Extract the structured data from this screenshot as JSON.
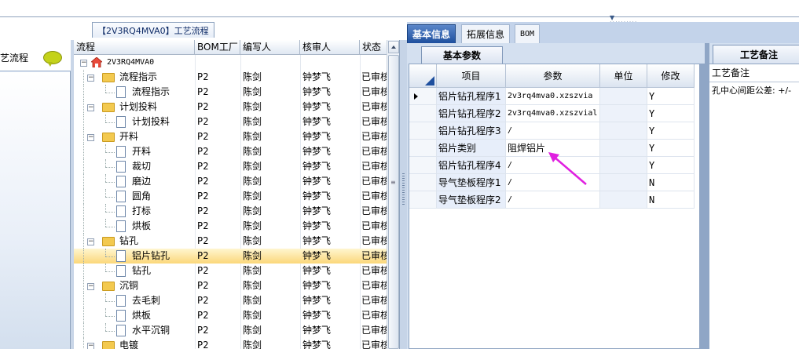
{
  "caption": "【2V3RQ4MVA0】工艺流程",
  "left_panel": {
    "label": "艺流程",
    "icon": "chat-bubble-icon"
  },
  "tree": {
    "columns": [
      "流程",
      "BOM工厂",
      "编写人",
      "核审人",
      "状态"
    ],
    "root": "2V3RQ4MVA0",
    "rows": [
      {
        "name": "流程指示",
        "type": "folder",
        "level": 1,
        "bom": "P2",
        "writer": "陈剑",
        "reviewer": "钟梦飞",
        "status": "已审核"
      },
      {
        "name": "流程指示",
        "type": "doc",
        "level": 2,
        "bom": "P2",
        "writer": "陈剑",
        "reviewer": "钟梦飞",
        "status": "已审核"
      },
      {
        "name": "计划投料",
        "type": "folder",
        "level": 1,
        "bom": "P2",
        "writer": "陈剑",
        "reviewer": "钟梦飞",
        "status": "已审核"
      },
      {
        "name": "计划投料",
        "type": "doc",
        "level": 2,
        "bom": "P2",
        "writer": "陈剑",
        "reviewer": "钟梦飞",
        "status": "已审核"
      },
      {
        "name": "开料",
        "type": "folder",
        "level": 1,
        "bom": "P2",
        "writer": "陈剑",
        "reviewer": "钟梦飞",
        "status": "已审核"
      },
      {
        "name": "开料",
        "type": "doc",
        "level": 2,
        "bom": "P2",
        "writer": "陈剑",
        "reviewer": "钟梦飞",
        "status": "已审核"
      },
      {
        "name": "裁切",
        "type": "doc",
        "level": 2,
        "bom": "P2",
        "writer": "陈剑",
        "reviewer": "钟梦飞",
        "status": "已审核"
      },
      {
        "name": "磨边",
        "type": "doc",
        "level": 2,
        "bom": "P2",
        "writer": "陈剑",
        "reviewer": "钟梦飞",
        "status": "已审核"
      },
      {
        "name": "圆角",
        "type": "doc",
        "level": 2,
        "bom": "P2",
        "writer": "陈剑",
        "reviewer": "钟梦飞",
        "status": "已审核"
      },
      {
        "name": "打标",
        "type": "doc",
        "level": 2,
        "bom": "P2",
        "writer": "陈剑",
        "reviewer": "钟梦飞",
        "status": "已审核"
      },
      {
        "name": "烘板",
        "type": "doc",
        "level": 2,
        "bom": "P2",
        "writer": "陈剑",
        "reviewer": "钟梦飞",
        "status": "已审核"
      },
      {
        "name": "钻孔",
        "type": "folder",
        "level": 1,
        "bom": "P2",
        "writer": "陈剑",
        "reviewer": "钟梦飞",
        "status": "已审核"
      },
      {
        "name": "铝片钻孔",
        "type": "doc",
        "level": 2,
        "bom": "P2",
        "writer": "陈剑",
        "reviewer": "钟梦飞",
        "status": "已审核",
        "selected": true
      },
      {
        "name": "钻孔",
        "type": "doc",
        "level": 2,
        "bom": "P2",
        "writer": "陈剑",
        "reviewer": "钟梦飞",
        "status": "已审核"
      },
      {
        "name": "沉铜",
        "type": "folder",
        "level": 1,
        "bom": "P2",
        "writer": "陈剑",
        "reviewer": "钟梦飞",
        "status": "已审核"
      },
      {
        "name": "去毛刺",
        "type": "doc",
        "level": 2,
        "bom": "P2",
        "writer": "陈剑",
        "reviewer": "钟梦飞",
        "status": "已审核"
      },
      {
        "name": "烘板",
        "type": "doc",
        "level": 2,
        "bom": "P2",
        "writer": "陈剑",
        "reviewer": "钟梦飞",
        "status": "已审核"
      },
      {
        "name": "水平沉铜",
        "type": "doc",
        "level": 2,
        "bom": "P2",
        "writer": "陈剑",
        "reviewer": "钟梦飞",
        "status": "已审核"
      },
      {
        "name": "电镀",
        "type": "folder",
        "level": 1,
        "bom": "P2",
        "writer": "陈剑",
        "reviewer": "钟梦飞",
        "status": "已审核"
      }
    ]
  },
  "right_tabs": [
    "基本信息",
    "拓展信息",
    "BOM"
  ],
  "basic_params": {
    "title": "基本参数",
    "columns": [
      "项目",
      "参数",
      "单位",
      "修改"
    ],
    "rows": [
      {
        "item": "铝片钻孔程序1",
        "param": "2v3rq4mva0.xzszvia",
        "unit": "",
        "modify": "Y",
        "current": true
      },
      {
        "item": "铝片钻孔程序2",
        "param": "2v3rq4mva0.xzszvial",
        "unit": "",
        "modify": "Y"
      },
      {
        "item": "铝片钻孔程序3",
        "param": "/",
        "unit": "",
        "modify": "Y"
      },
      {
        "item": "铝片类别",
        "param": "阻焊铝片",
        "unit": "",
        "modify": "Y"
      },
      {
        "item": "铝片钻孔程序4",
        "param": "/",
        "unit": "",
        "modify": "Y"
      },
      {
        "item": "导气垫板程序1",
        "param": "/",
        "unit": "",
        "modify": "N"
      },
      {
        "item": "导气垫板程序2",
        "param": "/",
        "unit": "",
        "modify": "N"
      }
    ]
  },
  "remarks": {
    "title": "工艺备注",
    "header": "工艺备注",
    "text": "孔中心间距公差: +/-"
  },
  "colors": {
    "accent": "#1e4f9e",
    "selection": "#fbd77a",
    "annotation_arrow": "#e020e0"
  }
}
